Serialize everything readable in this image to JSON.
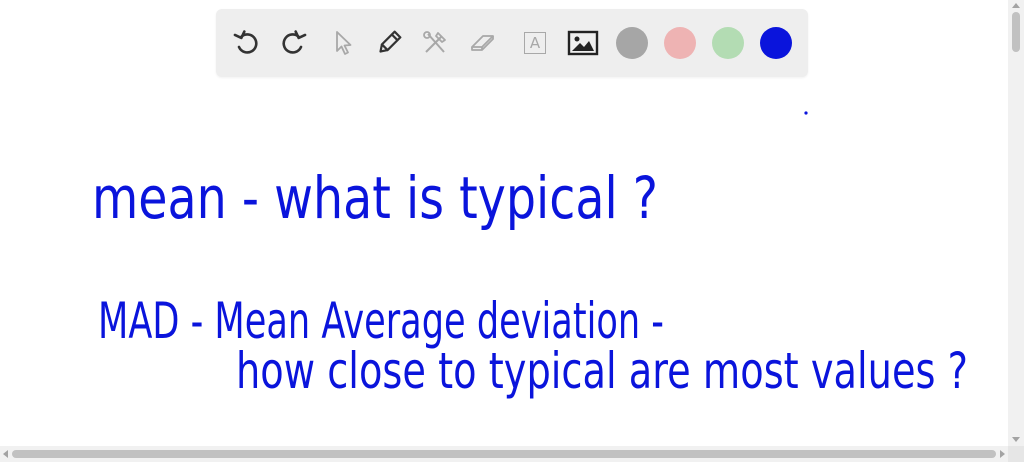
{
  "toolbar": {
    "tools": [
      {
        "name": "undo-icon",
        "icon": "undo"
      },
      {
        "name": "redo-icon",
        "icon": "redo"
      },
      {
        "name": "select-pointer-icon",
        "icon": "pointer"
      },
      {
        "name": "pencil-icon",
        "icon": "pencil"
      },
      {
        "name": "tools-icon",
        "icon": "hammer-wrench"
      },
      {
        "name": "eraser-icon",
        "icon": "eraser"
      },
      {
        "name": "text-icon",
        "icon": "text-box",
        "label": "A"
      },
      {
        "name": "image-icon",
        "icon": "image"
      }
    ],
    "colors": [
      {
        "name": "color-gray",
        "hex": "#a6a6a6"
      },
      {
        "name": "color-pink",
        "hex": "#eeb3b3"
      },
      {
        "name": "color-green",
        "hex": "#b3dcb3"
      },
      {
        "name": "color-blue",
        "hex": "#0a14dc",
        "selected": true
      }
    ]
  },
  "notes": {
    "line1": "mean - what is typical ?",
    "line2": "MAD - Mean Average deviation -",
    "line3": "how close to typical are most values ?",
    "ink_color": "#0a14dc"
  }
}
